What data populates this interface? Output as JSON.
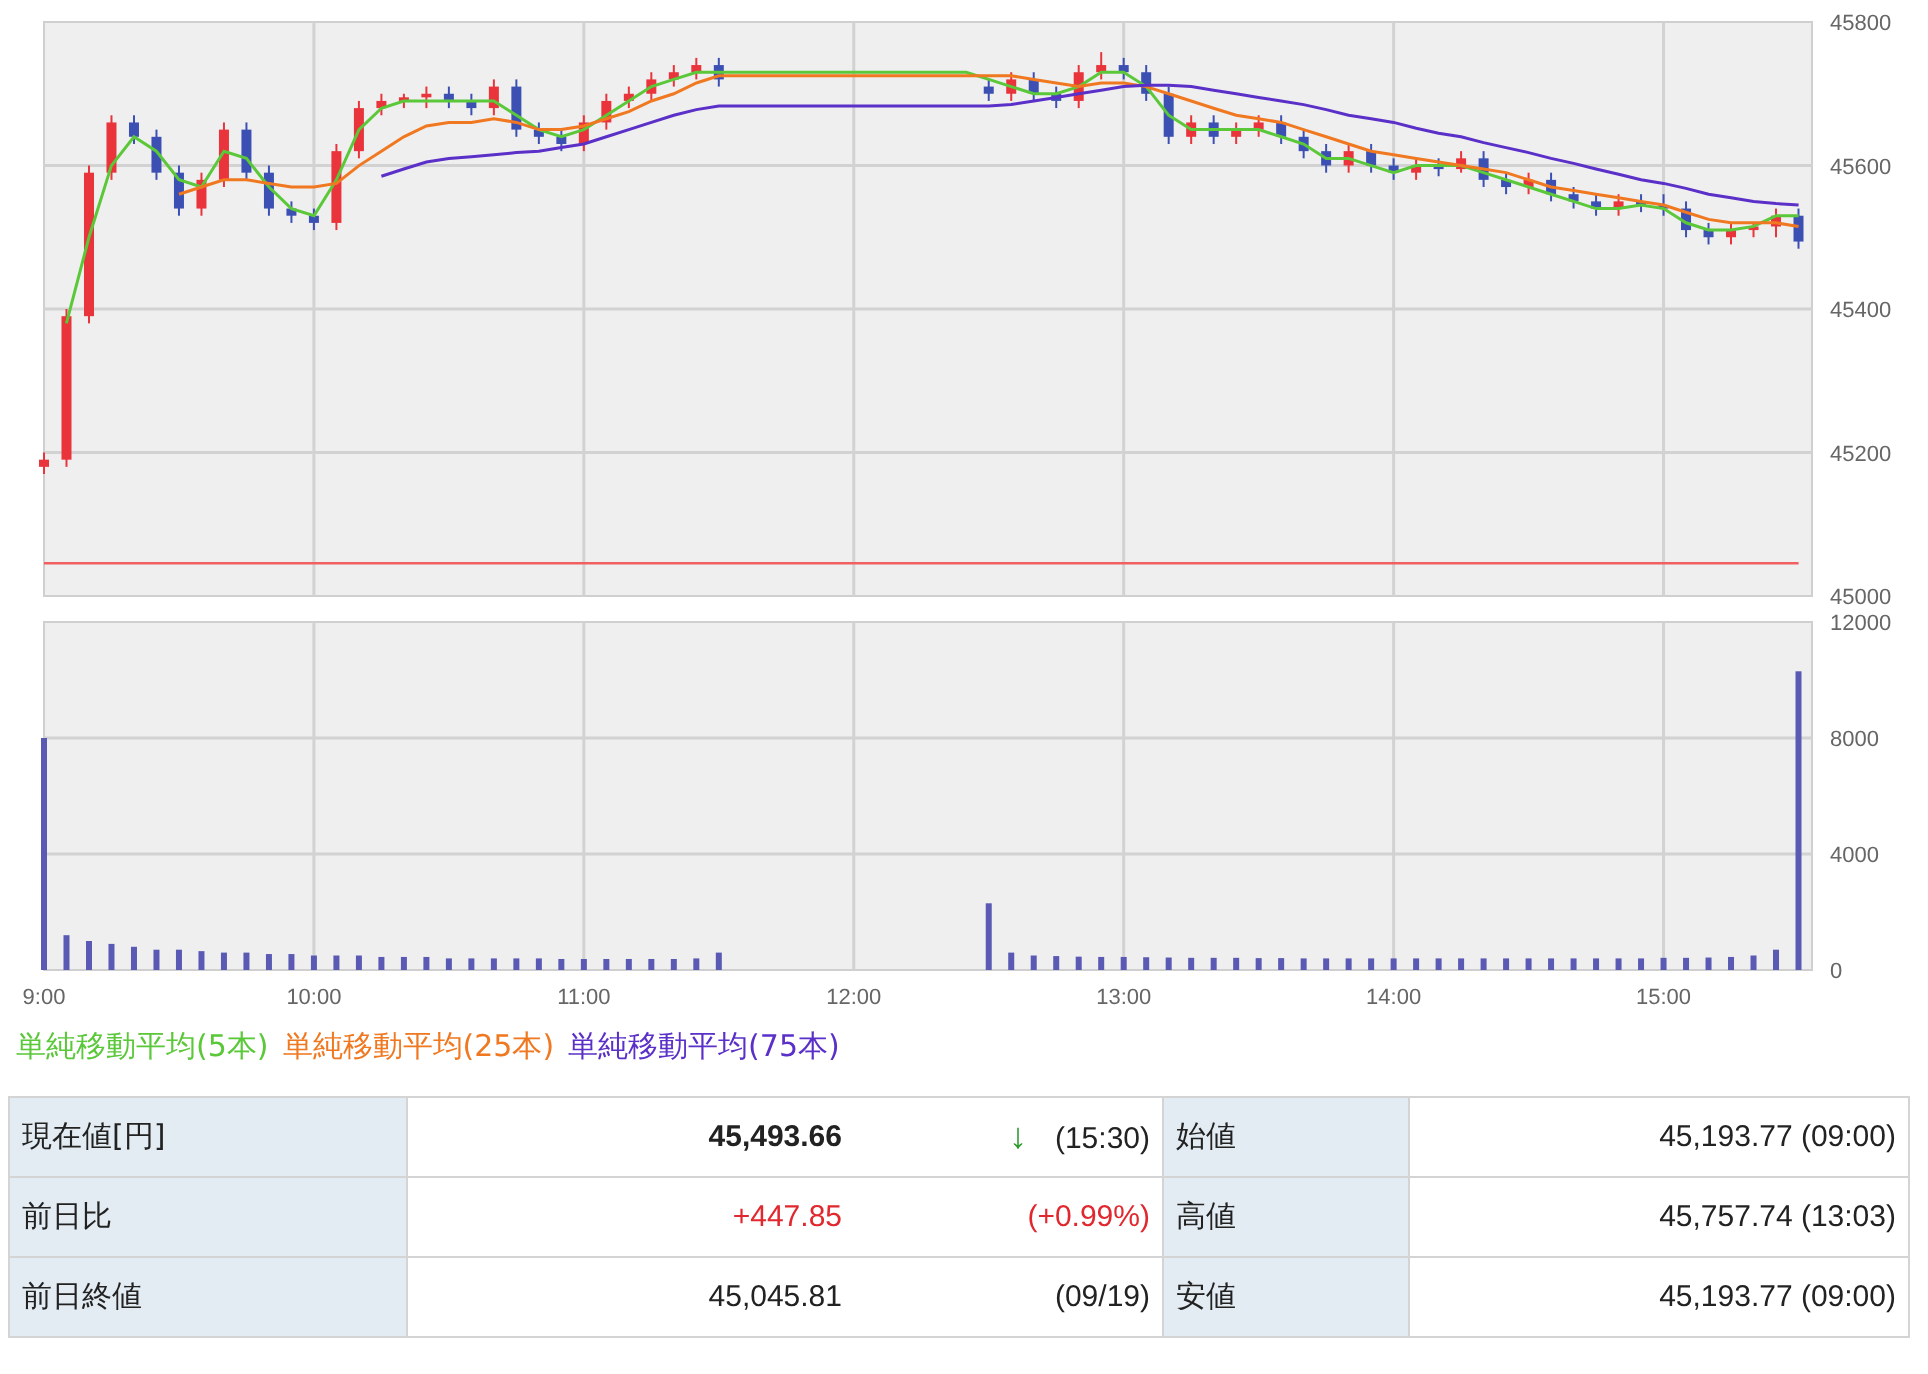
{
  "price_chart": {
    "chart_data": {
      "type": "candlestick",
      "ohlc": [
        [
          45180,
          45200,
          45170,
          45190
        ],
        [
          45190,
          45400,
          45180,
          45390
        ],
        [
          45390,
          45600,
          45380,
          45590
        ],
        [
          45590,
          45670,
          45580,
          45660
        ],
        [
          45660,
          45670,
          45630,
          45640
        ],
        [
          45640,
          45650,
          45580,
          45590
        ],
        [
          45590,
          45600,
          45530,
          45540
        ],
        [
          45540,
          45590,
          45530,
          45580
        ],
        [
          45580,
          45660,
          45570,
          45650
        ],
        [
          45650,
          45660,
          45580,
          45590
        ],
        [
          45590,
          45600,
          45530,
          45540
        ],
        [
          45540,
          45550,
          45520,
          45530
        ],
        [
          45530,
          45540,
          45510,
          45520
        ],
        [
          45520,
          45630,
          45510,
          45620
        ],
        [
          45620,
          45690,
          45610,
          45680
        ],
        [
          45680,
          45700,
          45670,
          45690
        ],
        [
          45690,
          45700,
          45680,
          45695
        ],
        [
          45695,
          45710,
          45680,
          45700
        ],
        [
          45700,
          45710,
          45680,
          45690
        ],
        [
          45690,
          45700,
          45670,
          45680
        ],
        [
          45680,
          45720,
          45670,
          45710
        ],
        [
          45710,
          45720,
          45640,
          45650
        ],
        [
          45650,
          45660,
          45630,
          45640
        ],
        [
          45640,
          45650,
          45620,
          45630
        ],
        [
          45630,
          45670,
          45620,
          45660
        ],
        [
          45660,
          45700,
          45650,
          45690
        ],
        [
          45690,
          45710,
          45680,
          45700
        ],
        [
          45700,
          45730,
          45690,
          45720
        ],
        [
          45720,
          45740,
          45710,
          45730
        ],
        [
          45730,
          45750,
          45720,
          45740
        ],
        [
          45740,
          45750,
          45710,
          45720
        ],
        null,
        null,
        null,
        null,
        null,
        null,
        null,
        null,
        null,
        null,
        null,
        [
          45710,
          45720,
          45690,
          45700
        ],
        [
          45700,
          45730,
          45690,
          45720
        ],
        [
          45720,
          45730,
          45690,
          45700
        ],
        [
          45700,
          45710,
          45680,
          45690
        ],
        [
          45690,
          45740,
          45680,
          45730
        ],
        [
          45730,
          45758,
          45720,
          45740
        ],
        [
          45740,
          45750,
          45720,
          45730
        ],
        [
          45730,
          45740,
          45690,
          45700
        ],
        [
          45700,
          45710,
          45630,
          45640
        ],
        [
          45640,
          45670,
          45630,
          45660
        ],
        [
          45660,
          45670,
          45630,
          45640
        ],
        [
          45640,
          45660,
          45630,
          45650
        ],
        [
          45650,
          45670,
          45640,
          45660
        ],
        [
          45660,
          45670,
          45630,
          45640
        ],
        [
          45640,
          45650,
          45610,
          45620
        ],
        [
          45620,
          45630,
          45590,
          45600
        ],
        [
          45600,
          45630,
          45590,
          45620
        ],
        [
          45620,
          45630,
          45590,
          45600
        ],
        [
          45600,
          45610,
          45580,
          45590
        ],
        [
          45590,
          45610,
          45580,
          45600
        ],
        [
          45600,
          45610,
          45585,
          45595
        ],
        [
          45595,
          45620,
          45590,
          45610
        ],
        [
          45610,
          45620,
          45570,
          45580
        ],
        [
          45580,
          45590,
          45560,
          45570
        ],
        [
          45570,
          45590,
          45560,
          45580
        ],
        [
          45580,
          45590,
          45550,
          45560
        ],
        [
          45560,
          45570,
          45540,
          45550
        ],
        [
          45550,
          45560,
          45530,
          45540
        ],
        [
          45540,
          45560,
          45530,
          45550
        ],
        [
          45550,
          45560,
          45535,
          45545
        ],
        [
          45545,
          45560,
          45530,
          45540
        ],
        [
          45540,
          45550,
          45500,
          45510
        ],
        [
          45510,
          45520,
          45490,
          45500
        ],
        [
          45500,
          45520,
          45490,
          45510
        ],
        [
          45510,
          45520,
          45500,
          45515
        ],
        [
          45515,
          45540,
          45500,
          45530
        ],
        [
          45530,
          45540,
          45484,
          45494
        ]
      ],
      "ylim": [
        45000,
        45800
      ],
      "yticks": [
        45000,
        45200,
        45400,
        45600,
        45800
      ],
      "grid": true
    }
  },
  "moving_average_chart": {
    "chart_data": {
      "type": "line",
      "series": [
        {
          "name": "単純移動平均(5本)",
          "color": "#5bc83a",
          "values": [
            null,
            45380,
            45500,
            45600,
            45640,
            45620,
            45580,
            45570,
            45620,
            45610,
            45570,
            45540,
            45530,
            45580,
            45650,
            45680,
            45690,
            45690,
            45690,
            45690,
            45690,
            45670,
            45650,
            45640,
            45650,
            45670,
            45690,
            45710,
            45720,
            45730,
            45730,
            45730,
            45730,
            45730,
            45730,
            45730,
            45730,
            45730,
            45730,
            45730,
            45730,
            45730,
            45720,
            45710,
            45700,
            45700,
            45710,
            45730,
            45730,
            45710,
            45670,
            45650,
            45650,
            45650,
            45650,
            45640,
            45630,
            45610,
            45610,
            45600,
            45590,
            45600,
            45600,
            45600,
            45590,
            45580,
            45570,
            45560,
            45550,
            45540,
            45540,
            45545,
            45540,
            45520,
            45510,
            45510,
            45515,
            45530,
            45530
          ]
        },
        {
          "name": "単純移動平均(25本)",
          "color": "#f07820",
          "values": [
            null,
            null,
            null,
            null,
            null,
            null,
            45560,
            45570,
            45580,
            45580,
            45575,
            45570,
            45570,
            45575,
            45600,
            45620,
            45640,
            45655,
            45660,
            45660,
            45665,
            45660,
            45650,
            45650,
            45655,
            45665,
            45675,
            45690,
            45700,
            45715,
            45725,
            45725,
            45725,
            45725,
            45725,
            45725,
            45725,
            45725,
            45725,
            45725,
            45725,
            45725,
            45725,
            45725,
            45720,
            45715,
            45710,
            45715,
            45715,
            45710,
            45700,
            45690,
            45680,
            45670,
            45665,
            45660,
            45650,
            45640,
            45630,
            45620,
            45615,
            45610,
            45605,
            45600,
            45595,
            45590,
            45580,
            45570,
            45565,
            45560,
            45555,
            45550,
            45545,
            45535,
            45525,
            45520,
            45520,
            45520,
            45515
          ]
        },
        {
          "name": "単純移動平均(75本)",
          "color": "#5a30c8",
          "values": [
            null,
            null,
            null,
            null,
            null,
            null,
            null,
            null,
            null,
            null,
            null,
            null,
            null,
            null,
            null,
            45585,
            45595,
            45605,
            45610,
            45612,
            45615,
            45618,
            45620,
            45625,
            45630,
            45640,
            45650,
            45660,
            45670,
            45678,
            45683,
            45683,
            45683,
            45683,
            45683,
            45683,
            45683,
            45683,
            45683,
            45683,
            45683,
            45683,
            45683,
            45685,
            45690,
            45695,
            45700,
            45705,
            45710,
            45712,
            45712,
            45710,
            45705,
            45700,
            45695,
            45690,
            45685,
            45678,
            45670,
            45665,
            45660,
            45652,
            45645,
            45640,
            45632,
            45625,
            45618,
            45610,
            45603,
            45595,
            45588,
            45580,
            45575,
            45568,
            45560,
            45555,
            45550,
            45547,
            45545
          ]
        },
        {
          "color": "#f06060",
          "values": [
            45045.81,
            45045.81,
            45045.81,
            45045.81,
            45045.81,
            45045.81,
            45045.81,
            45045.81,
            45045.81,
            45045.81,
            45045.81,
            45045.81,
            45045.81,
            45045.81,
            45045.81,
            45045.81,
            45045.81,
            45045.81,
            45045.81,
            45045.81,
            45045.81,
            45045.81,
            45045.81,
            45045.81,
            45045.81,
            45045.81,
            45045.81,
            45045.81,
            45045.81,
            45045.81,
            45045.81,
            45045.81,
            45045.81,
            45045.81,
            45045.81,
            45045.81,
            45045.81,
            45045.81,
            45045.81,
            45045.81,
            45045.81,
            45045.81,
            45045.81,
            45045.81,
            45045.81,
            45045.81,
            45045.81,
            45045.81,
            45045.81,
            45045.81,
            45045.81,
            45045.81,
            45045.81,
            45045.81,
            45045.81,
            45045.81,
            45045.81,
            45045.81,
            45045.81,
            45045.81,
            45045.81,
            45045.81,
            45045.81,
            45045.81,
            45045.81,
            45045.81,
            45045.81,
            45045.81,
            45045.81,
            45045.81,
            45045.81,
            45045.81,
            45045.81,
            45045.81,
            45045.81,
            45045.81,
            45045.81,
            45045.81,
            45045.81
          ]
        }
      ],
      "ylim": [
        45000,
        45800
      ]
    }
  },
  "volume_chart": {
    "chart_data": {
      "type": "bar",
      "categories": [
        "9:00",
        null,
        null,
        null,
        null,
        null,
        null,
        null,
        null,
        null,
        null,
        null,
        "10:00",
        null,
        null,
        null,
        null,
        null,
        null,
        null,
        null,
        null,
        null,
        null,
        "11:00",
        null,
        null,
        null,
        null,
        null,
        null,
        null,
        null,
        null,
        null,
        null,
        "12:00",
        null,
        null,
        null,
        null,
        null,
        null,
        null,
        null,
        null,
        null,
        null,
        "13:00",
        null,
        null,
        null,
        null,
        null,
        null,
        null,
        null,
        null,
        null,
        null,
        "14:00",
        null,
        null,
        null,
        null,
        null,
        null,
        null,
        null,
        null,
        null,
        null,
        "15:00",
        null,
        null,
        null,
        null,
        null,
        null
      ],
      "values": [
        8000,
        1200,
        1000,
        900,
        800,
        700,
        700,
        650,
        600,
        600,
        550,
        550,
        500,
        500,
        500,
        450,
        450,
        450,
        400,
        400,
        400,
        400,
        400,
        380,
        380,
        380,
        380,
        380,
        380,
        400,
        600,
        null,
        null,
        null,
        null,
        null,
        null,
        null,
        null,
        null,
        null,
        null,
        2300,
        600,
        500,
        480,
        460,
        450,
        450,
        440,
        430,
        420,
        420,
        420,
        410,
        410,
        400,
        400,
        400,
        400,
        400,
        400,
        400,
        400,
        400,
        400,
        400,
        400,
        400,
        400,
        400,
        400,
        420,
        420,
        430,
        450,
        500,
        700,
        10300
      ],
      "ylim": [
        0,
        12000
      ],
      "yticks": [
        0,
        4000,
        8000,
        12000
      ],
      "grid": true
    }
  },
  "quote_table": [
    {
      "label": "現在値[円]",
      "value": "45,493.66",
      "value_bold": true,
      "arrow": "↓",
      "note": "(15:30)",
      "label2": "始値",
      "value2": "45,193.77 (09:00)"
    },
    {
      "label": "前日比",
      "value": "+447.85",
      "value_bold": false,
      "color": "#e0282e",
      "note": "(+0.99%)",
      "label2": "高値",
      "value2": "45,757.74 (13:03)"
    },
    {
      "label": "前日終値",
      "value": "45,045.81",
      "value_bold": false,
      "note": "(09/19)",
      "label2": "安値",
      "value2": "45,193.77 (09:00)"
    }
  ]
}
